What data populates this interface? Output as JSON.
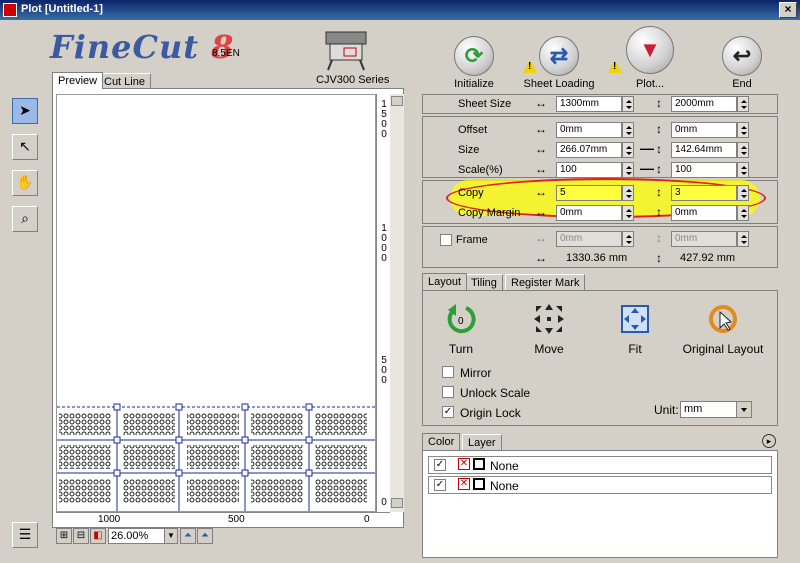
{
  "window": {
    "title": "Plot [Untitled-1]",
    "close_glyph": "×"
  },
  "header": {
    "logo_main": "FineCut ",
    "logo_number": "8",
    "version": "8.5EN",
    "device": "CJV300 Series"
  },
  "actions": [
    {
      "label": "Initialize",
      "symbol": "⟳",
      "color": "#2e9e3a"
    },
    {
      "label": "Sheet Loading",
      "symbol": "⇄",
      "color": "#2a5ab0"
    },
    {
      "label": "Plot...",
      "symbol": "▼",
      "color": "#c82030"
    },
    {
      "label": "End",
      "symbol": "↩",
      "color": "#222222"
    }
  ],
  "warning_glyph": "!",
  "preview_tabs": [
    "Preview",
    "Cut Line"
  ],
  "vruler": {
    "group1": [
      "1",
      "5",
      "0",
      "0"
    ],
    "group2": [
      "1",
      "0",
      "0",
      "0"
    ],
    "group3": [
      "5",
      "0",
      "0"
    ],
    "end": "0"
  },
  "hruler": {
    "a": "1000",
    "b": "500",
    "c": "0"
  },
  "zoom": "26.00%",
  "sheet": {
    "label": "Sheet Size",
    "w": "1300mm",
    "h": "2000mm"
  },
  "offset": {
    "label": "Offset",
    "w": "0mm",
    "h": "0mm"
  },
  "size": {
    "label": "Size",
    "w": "266.07mm",
    "h": "142.64mm"
  },
  "scale": {
    "label": "Scale(%)",
    "w": "100",
    "h": "100"
  },
  "copy": {
    "label": "Copy",
    "w": "5",
    "h": "3"
  },
  "copy_margin": {
    "label": "Copy Margin",
    "w": "0mm",
    "h": "0mm"
  },
  "frame": {
    "label": "Frame",
    "w": "0mm",
    "h": "0mm"
  },
  "totals": {
    "w": "1330.36 mm",
    "h": "427.92 mm"
  },
  "layout_tabs": [
    "Layout",
    "Tiling",
    "Register Mark"
  ],
  "layout_actions": [
    "Turn",
    "Move",
    "Fit",
    "Original Layout"
  ],
  "turn_badge": "0",
  "options": {
    "mirror": "Mirror",
    "unlock_scale": "Unlock Scale",
    "origin_lock": "Origin Lock",
    "checkmark": "✓"
  },
  "unit": {
    "label": "Unit:",
    "value": "mm"
  },
  "color_tabs": [
    "Color",
    "Layer"
  ],
  "layers": [
    {
      "name": "None"
    },
    {
      "name": "None"
    }
  ],
  "glyphs": {
    "arrow_h": "↔",
    "arrow_v": "↕",
    "link": "—",
    "more": "▸",
    "tick": "✓",
    "x": "✕"
  }
}
